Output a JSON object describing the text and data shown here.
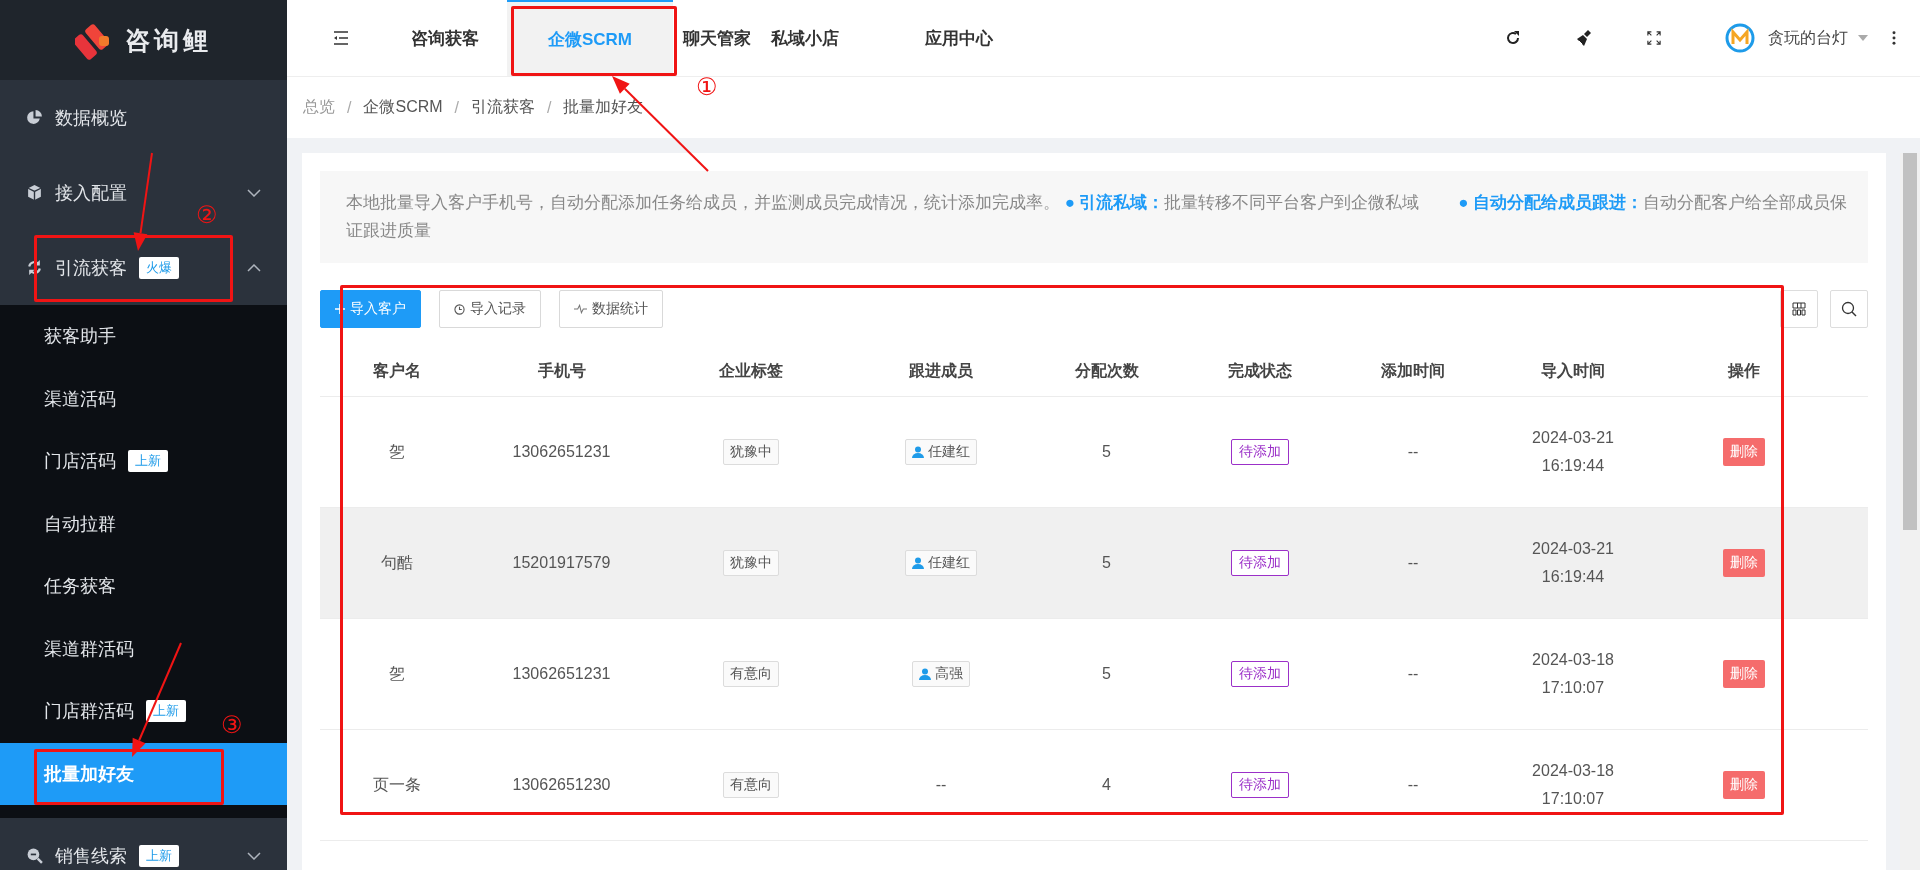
{
  "sidebar": {
    "logo": "咨询鲤",
    "items": [
      {
        "kind": "link",
        "label": "数据概览"
      },
      {
        "kind": "group",
        "label": "接入配置",
        "expanded": false
      },
      {
        "kind": "group",
        "label": "引流获客",
        "badge": "火爆",
        "expanded": true,
        "children": [
          {
            "label": "获客助手",
            "selected": false
          },
          {
            "label": "渠道活码",
            "selected": false
          },
          {
            "label": "门店活码",
            "badge": "上新",
            "selected": false
          },
          {
            "label": "自动拉群",
            "selected": false
          },
          {
            "label": "任务获客",
            "selected": false
          },
          {
            "label": "渠道群活码",
            "selected": false
          },
          {
            "label": "门店群活码",
            "badge": "上新",
            "selected": false
          },
          {
            "label": "批量加好友",
            "selected": true
          }
        ]
      },
      {
        "kind": "group",
        "label": "销售线索",
        "badge": "上新",
        "expanded": false
      }
    ]
  },
  "topbar": {
    "tabs": [
      {
        "label": "咨询获客",
        "selected": false
      },
      {
        "label": "企微SCRM",
        "selected": true
      },
      {
        "label": "聊天管家",
        "selected": false
      },
      {
        "label": "私域小店",
        "selected": false
      },
      {
        "label": "应用中心",
        "selected": false
      }
    ],
    "user": "贪玩的台灯"
  },
  "breadcrumb": {
    "separator": "/",
    "items": [
      "总览",
      "企微SCRM",
      "引流获客",
      "批量加好友"
    ]
  },
  "description": "本地批量导入客户手机号，自动分配添加任务给成员，并监测成员完成情况，统计添加完成率。 **● 引流私域：**批量转移不同平台客户到企微私域　　 **● 自动分配给成员跟进：**自动分配客户给全部成员保证跟进质量",
  "toolbar": {
    "buttons": [
      {
        "kind": "primary",
        "label": "导入客户"
      },
      {
        "kind": "default",
        "label": "导入记录"
      },
      {
        "kind": "default",
        "label": "数据统计"
      }
    ]
  },
  "table": {
    "columns": [
      "客户名",
      "手机号",
      "企业标签",
      "跟进成员",
      "分配次数",
      "完成状态",
      "添加时间",
      "导入时间",
      "操作"
    ],
    "rows": [
      {
        "hovered": false,
        "name": "乫",
        "phone": "13062651231",
        "tag": "犹豫中",
        "member": {
          "kind": "tag",
          "text": "任建红"
        },
        "count": "5",
        "status": "待添加",
        "added": "--",
        "date": "2024-03-21",
        "time": "16:19:44",
        "action": "删除"
      },
      {
        "hovered": true,
        "name": "句酷",
        "phone": "15201917579",
        "tag": "犹豫中",
        "member": {
          "kind": "tag",
          "text": "任建红"
        },
        "count": "5",
        "status": "待添加",
        "added": "--",
        "date": "2024-03-21",
        "time": "16:19:44",
        "action": "删除"
      },
      {
        "hovered": false,
        "name": "乫",
        "phone": "13062651231",
        "tag": "有意向",
        "member": {
          "kind": "tag",
          "text": "高强"
        },
        "count": "5",
        "status": "待添加",
        "added": "--",
        "date": "2024-03-18",
        "time": "17:10:07",
        "action": "删除"
      },
      {
        "hovered": false,
        "name": "页一条",
        "phone": "13062651230",
        "tag": "有意向",
        "member": {
          "kind": "empty",
          "text": "--"
        },
        "count": "4",
        "status": "待添加",
        "added": "--",
        "date": "2024-03-18",
        "time": "17:10:07",
        "action": "删除"
      }
    ]
  },
  "annotations": [
    {
      "label": "①"
    },
    {
      "label": "②"
    },
    {
      "label": "③"
    }
  ]
}
